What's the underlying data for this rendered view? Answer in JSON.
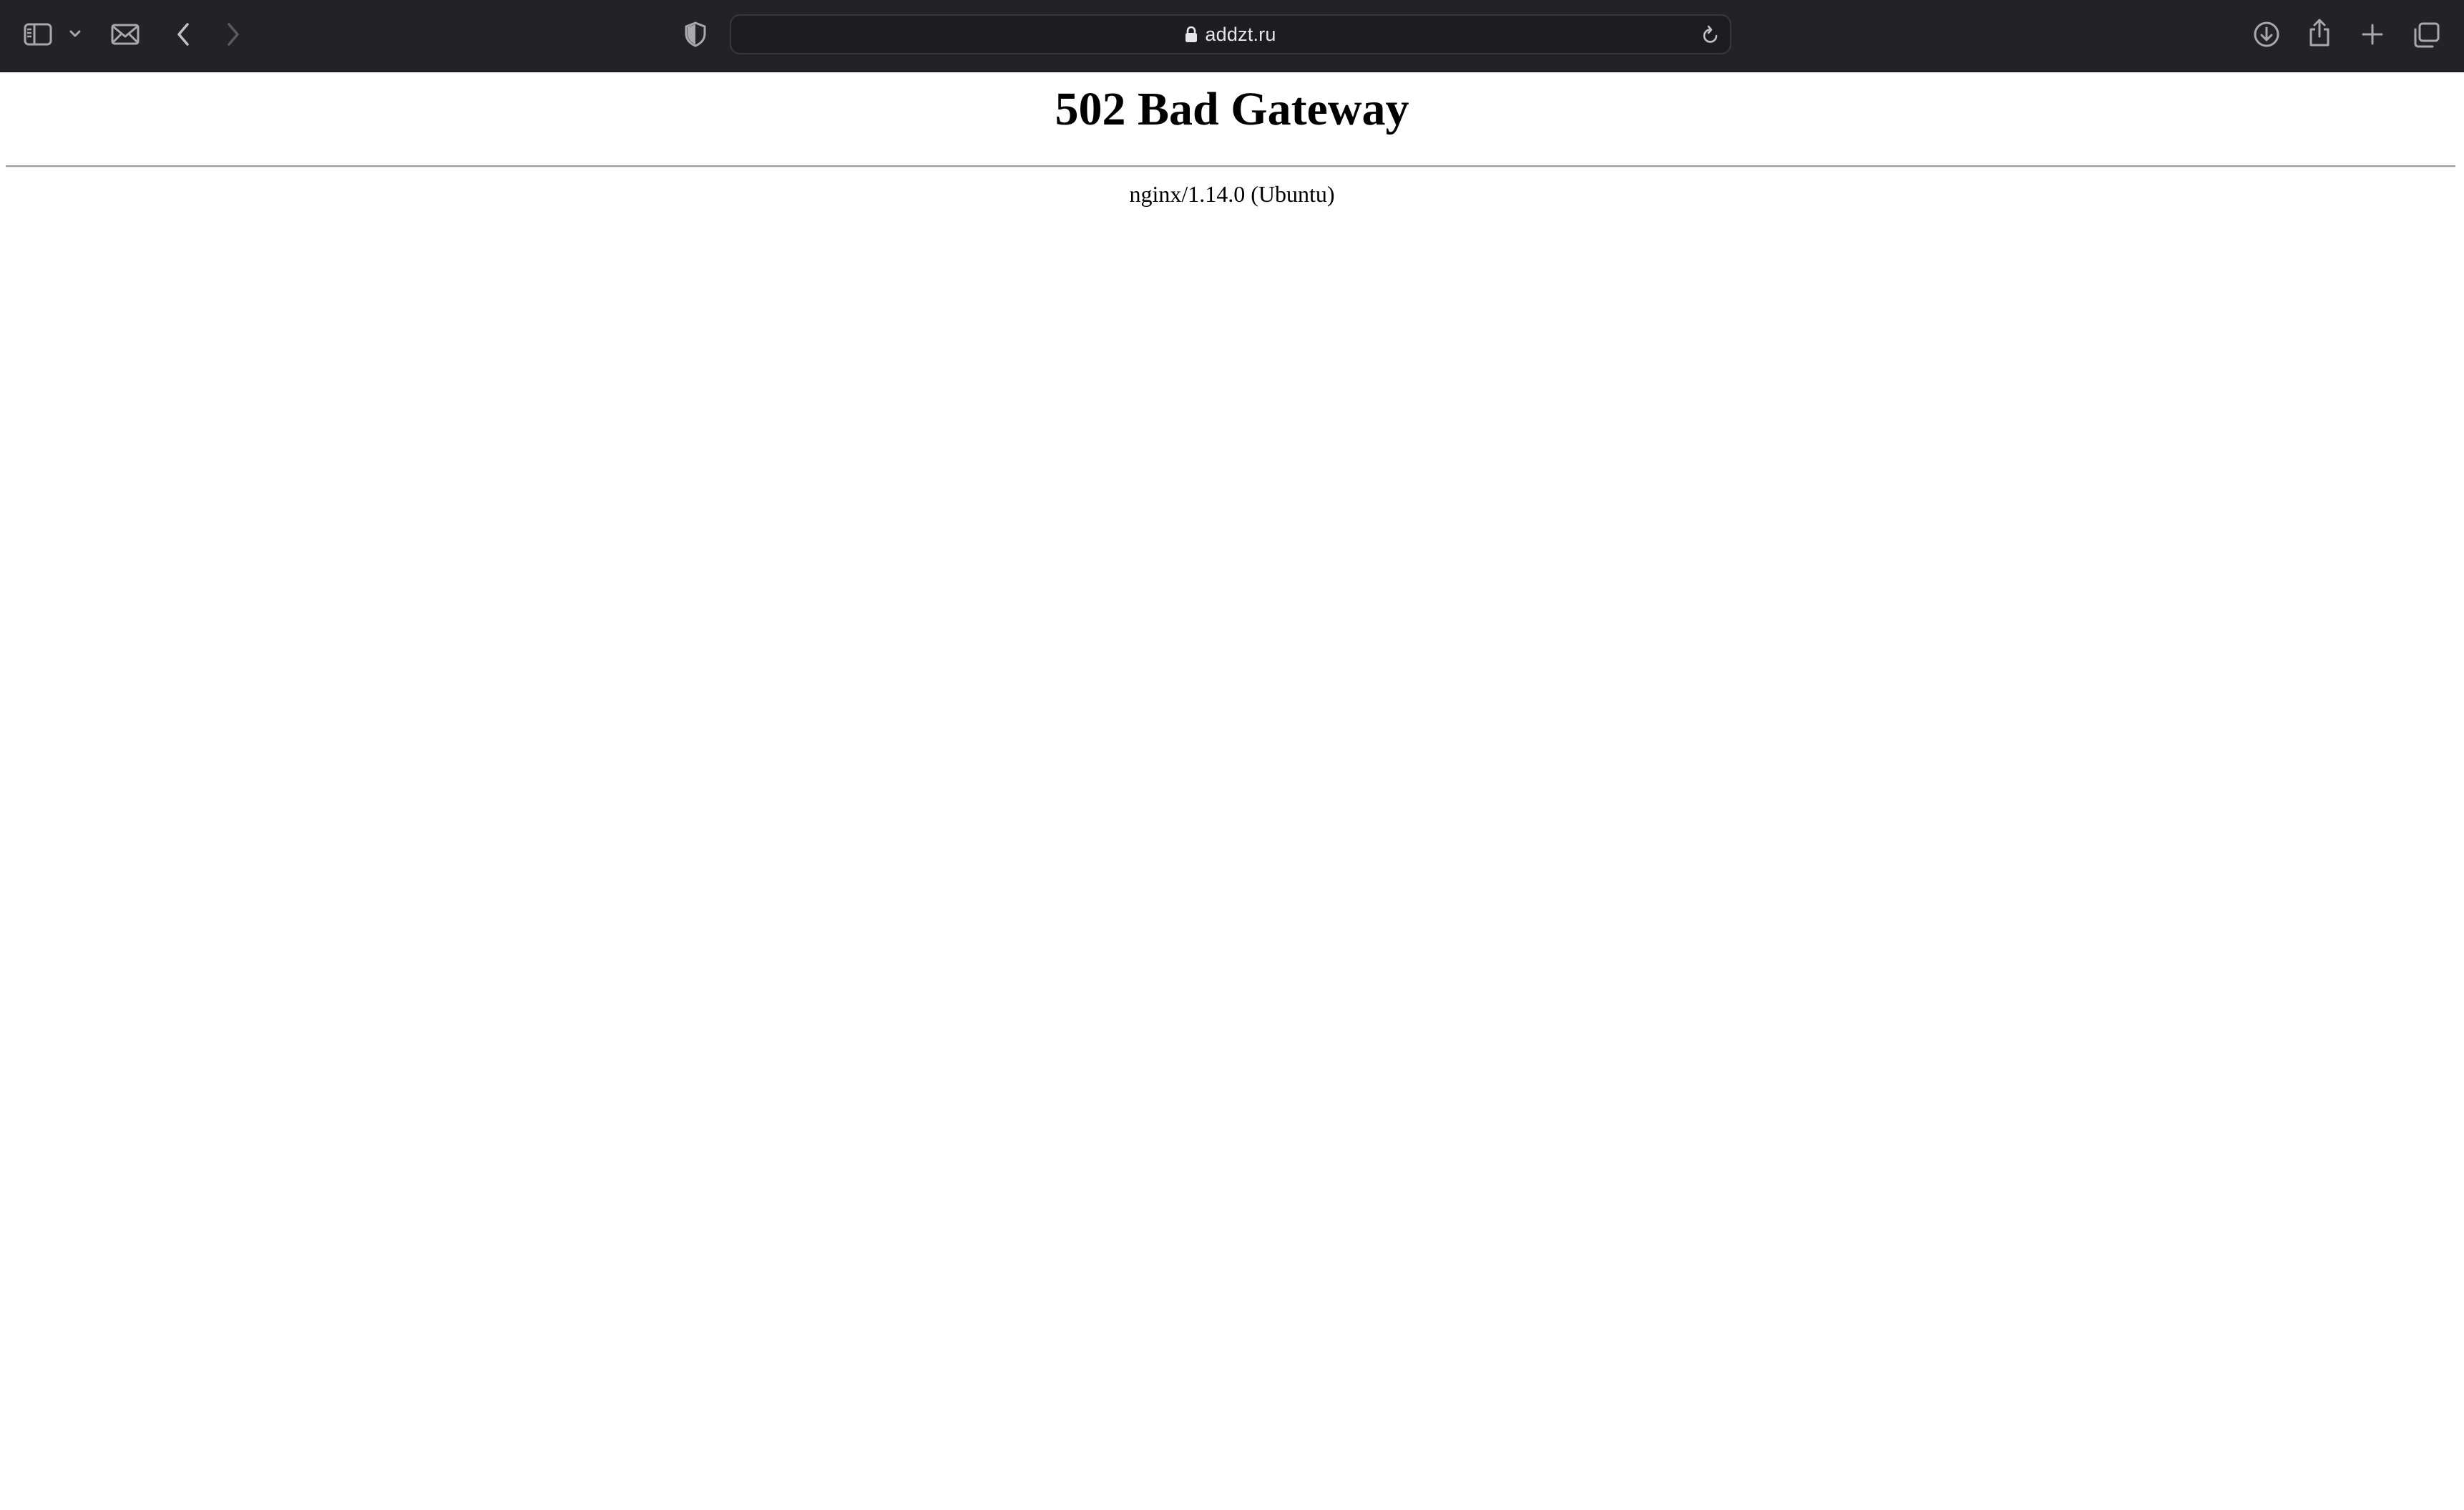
{
  "browser": {
    "url": "addzt.ru",
    "icons": {
      "sidebar": "sidebar-icon",
      "sidebar_menu": "chevron-down-icon",
      "tab_overview": "envelope-icon",
      "back": "chevron-left-icon",
      "forward": "chevron-right-icon",
      "privacy": "shield-icon",
      "lock": "lock-icon",
      "reload": "reload-icon",
      "downloads": "download-icon",
      "share": "share-icon",
      "new_tab": "plus-icon",
      "tabs": "tabs-icon"
    },
    "colors": {
      "toolbar_bg": "#232226",
      "icon": "#a9a8ad",
      "address_bg": "#1d1c20"
    }
  },
  "page": {
    "title": "502 Bad Gateway",
    "server_signature": "nginx/1.14.0 (Ubuntu)"
  }
}
